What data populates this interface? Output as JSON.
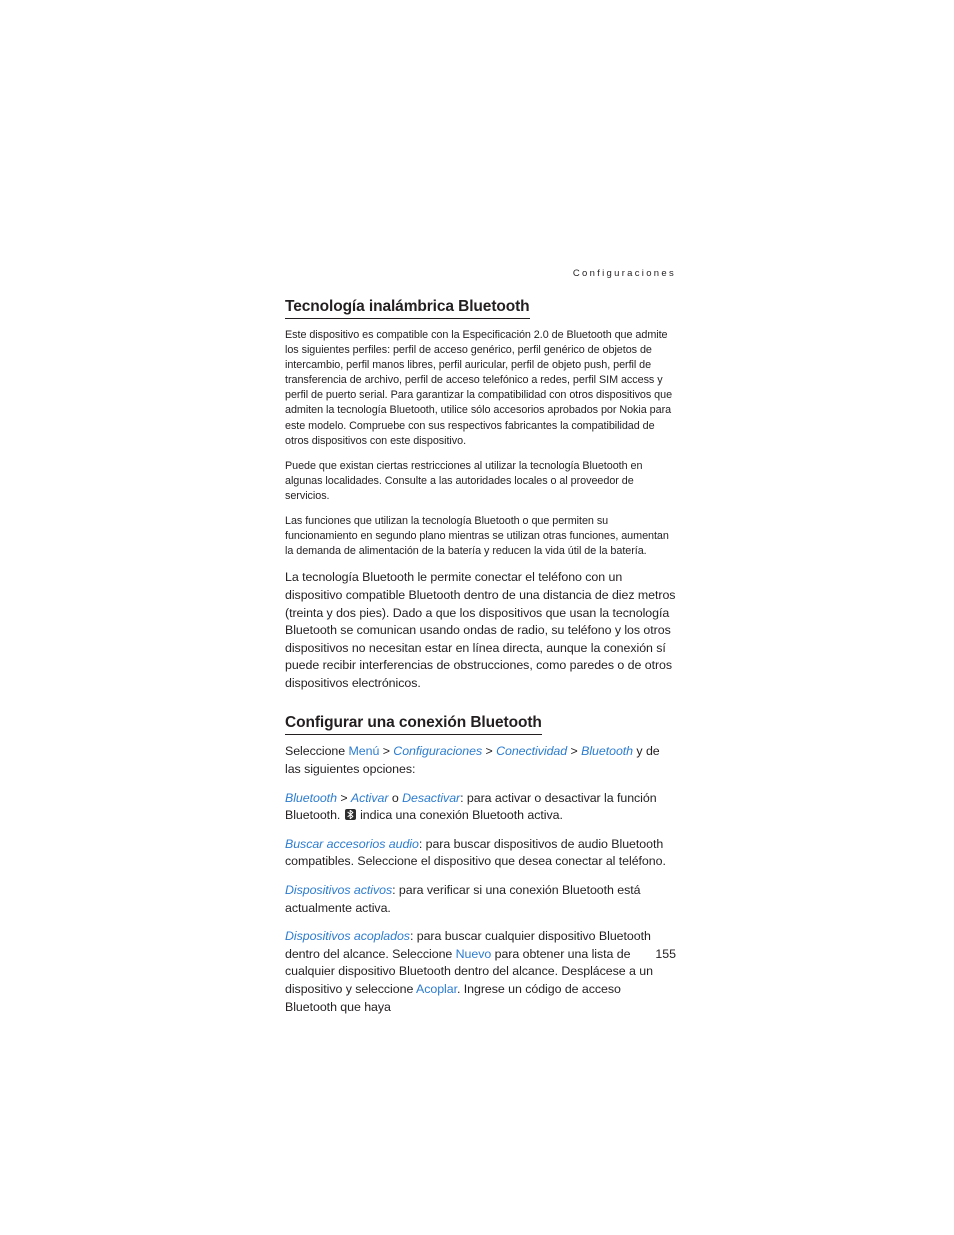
{
  "page": {
    "running_header": "Configuraciones",
    "folio": "155"
  },
  "sections": [
    {
      "heading": "Tecnología inalámbrica Bluetooth",
      "paragraphs": [
        "Este dispositivo es compatible con la Especificación 2.0 de Bluetooth que admite los siguientes perfiles: perfil de acceso genérico, perfil genérico de objetos de intercambio, perfil manos libres, perfil auricular, perfil de objeto push, perfil de transferencia de archivo, perfil de acceso telefónico a redes, perfil SIM access y perfil de puerto serial. Para garantizar la compatibilidad con otros dispositivos que admiten la tecnología Bluetooth, utilice sólo accesorios aprobados por Nokia para este modelo. Compruebe con sus respectivos fabricantes la compatibilidad de otros dispositivos con este dispositivo.",
        "Puede que existan ciertas restricciones al utilizar la tecnología Bluetooth en algunas localidades. Consulte a las autoridades locales o al proveedor de servicios.",
        "Las funciones que utilizan la tecnología Bluetooth o que permiten su funcionamiento en segundo plano mientras se utilizan otras funciones, aumentan la demanda de alimentación de la batería y reducen la vida útil de la batería.",
        "La tecnología Bluetooth le permite conectar el teléfono con un dispositivo compatible Bluetooth dentro de una distancia de diez metros (treinta y dos pies). Dado a que los dispositivos que usan la tecnología Bluetooth se comunican usando ondas de radio, su teléfono y los otros dispositivos no necesitan estar en línea directa, aunque la conexión sí puede recibir interferencias de obstrucciones, como paredes o de otros dispositivos electrónicos."
      ]
    },
    {
      "heading": "Configurar una conexión Bluetooth"
    }
  ],
  "menu_path": {
    "intro": "Seleccione ",
    "menu": "Menú",
    "sep1": " > ",
    "settings": "Configuraciones",
    "sep2": " > ",
    "connectivity": "Conectividad",
    "sep3": " > ",
    "bluetooth": "Bluetooth",
    "outro": " y de las siguientes opciones:"
  },
  "options": {
    "bluetooth": {
      "term": "Bluetooth",
      "sep1": " > ",
      "activate": "Activar",
      "conj": " o ",
      "deactivate": "Desactivar",
      "text_before_icon": ": para activar o desactivar la función Bluetooth. ",
      "icon": "bluetooth-icon",
      "text_after_icon": " indica una conexión Bluetooth activa."
    },
    "audio_accessories": {
      "term": "Buscar accesorios audio",
      "text": ": para buscar dispositivos de audio Bluetooth compatibles. Seleccione el dispositivo que desea conectar al teléfono."
    },
    "active_devices": {
      "term": "Dispositivos activos",
      "text": ": para verificar si una conexión Bluetooth está actualmente activa."
    },
    "paired_devices": {
      "term": "Dispositivos acoplados",
      "text_1": ": para buscar cualquier dispositivo Bluetooth dentro del alcance. Seleccione ",
      "new": "Nuevo",
      "text_2": " para obtener una lista de cualquier dispositivo Bluetooth dentro del alcance. Desplácese a un dispositivo y seleccione ",
      "pair": "Acoplar",
      "text_3": ". Ingrese un código de acceso Bluetooth que haya"
    }
  },
  "colors": {
    "link": "#2c7cd0",
    "text": "#231f20",
    "icon_background": "#2d2d2d"
  }
}
